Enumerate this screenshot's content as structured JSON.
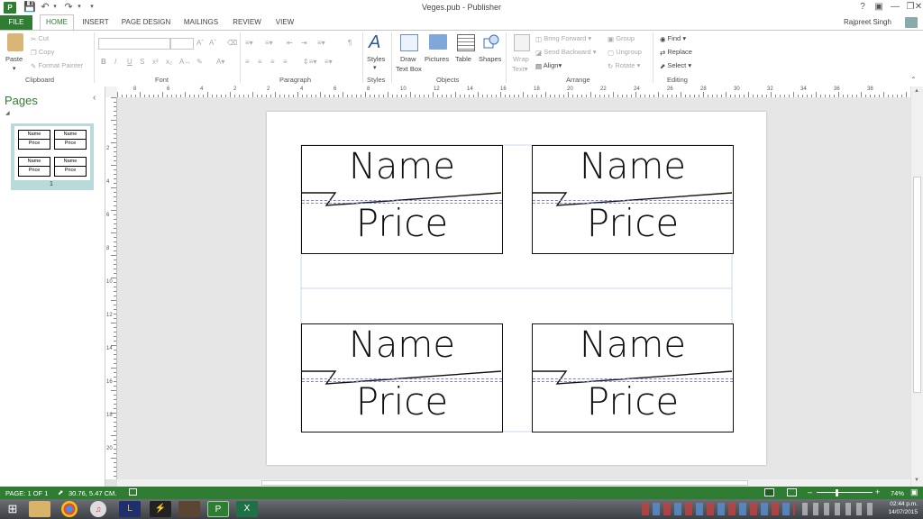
{
  "window": {
    "title": "Veges.pub - Publisher",
    "user": "Rajpreet Singh",
    "help": "?",
    "minimize": "—",
    "restore": "❐",
    "close": "✕"
  },
  "tabs": [
    "FILE",
    "HOME",
    "INSERT",
    "PAGE DESIGN",
    "MAILINGS",
    "REVIEW",
    "VIEW"
  ],
  "ribbon": {
    "clipboard": {
      "paste": "Paste",
      "cut": "Cut",
      "copy": "Copy",
      "format_painter": "Format Painter",
      "group": "Clipboard"
    },
    "font": {
      "group": "Font"
    },
    "paragraph": {
      "group": "Paragraph"
    },
    "styles": {
      "button": "Styles",
      "group": "Styles"
    },
    "objects": {
      "draw_text_box_1": "Draw",
      "draw_text_box_2": "Text Box",
      "pictures": "Pictures",
      "table": "Table",
      "shapes": "Shapes",
      "group": "Objects"
    },
    "arrange": {
      "wrap_text_1": "Wrap",
      "wrap_text_2": "Text",
      "bring_forward": "Bring Forward",
      "send_backward": "Send Backward",
      "align": "Align",
      "group_btn": "Group",
      "ungroup": "Ungroup",
      "rotate": "Rotate",
      "group": "Arrange"
    },
    "editing": {
      "find": "Find",
      "replace": "Replace",
      "select": "Select",
      "group": "Editing"
    }
  },
  "pages_pane": {
    "title": "Pages",
    "collapse": "‹",
    "thumb_number": "1",
    "thumb_name": "Name",
    "thumb_price": "Price"
  },
  "labels": [
    {
      "name": "Name",
      "price": "Price"
    },
    {
      "name": "Name",
      "price": "Price"
    },
    {
      "name": "Name",
      "price": "Price"
    },
    {
      "name": "Name",
      "price": "Price"
    }
  ],
  "rulers": {
    "h": [
      "8",
      "6",
      "4",
      "2",
      "2",
      "4",
      "6",
      "8",
      "10",
      "12",
      "14",
      "16",
      "18",
      "20",
      "22",
      "24",
      "26",
      "28",
      "30",
      "32",
      "34",
      "36",
      "38"
    ],
    "v": [
      "2",
      "4",
      "6",
      "8",
      "10",
      "12",
      "14",
      "16",
      "18",
      "20"
    ]
  },
  "status": {
    "page": "PAGE: 1 OF 1",
    "position": "30.76, 5.47 CM.",
    "zoom": "74%"
  },
  "taskbar": {
    "time": "02:44 p.m.",
    "date": "14/07/2015"
  },
  "colors": {
    "accent": "#2e7d32",
    "label_border": "#111111"
  }
}
